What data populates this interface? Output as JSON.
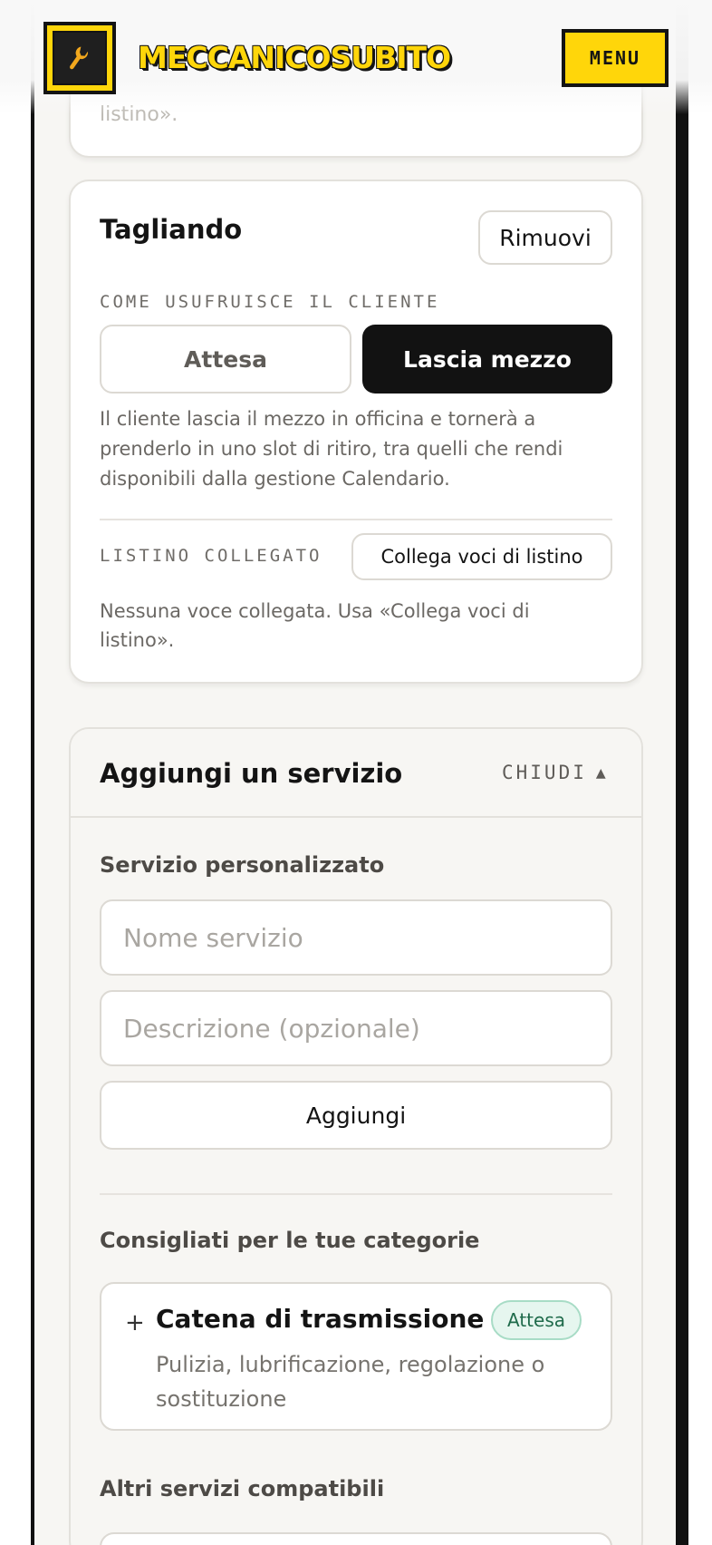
{
  "header": {
    "brand": "MECCANICOSUBITO",
    "menu_label": "MENU",
    "logo_icon": "wrench-icon",
    "accent": "#ffd60a"
  },
  "previous_card": {
    "tail_text": "listino»."
  },
  "service": {
    "title": "Tagliando",
    "remove_label": "Rimuovi",
    "usage_label": "COME USUFRUISCE IL CLIENTE",
    "option_wait": "Attesa",
    "option_leave": "Lascia mezzo",
    "selected": "Lascia mezzo",
    "usage_description": "Il cliente lascia il mezzo in officina e tornerà a prenderlo in uno slot di ritiro, tra quelli che rendi disponibili dalla gestione Calendario.",
    "listino_label": "LISTINO COLLEGATO",
    "link_list_label": "Collega voci di listino",
    "listino_empty": "Nessuna voce collegata. Usa «Collega voci di listino»."
  },
  "add_service": {
    "title": "Aggiungi un servizio",
    "close_label": "CHIUDI",
    "close_icon": "triangle-up-icon",
    "custom_heading": "Servizio personalizzato",
    "name_placeholder": "Nome servizio",
    "name_value": "",
    "description_placeholder": "Descrizione (opzionale)",
    "description_value": "",
    "add_label": "Aggiungi",
    "recommended_heading": "Consigliati per le tue categorie",
    "recommended": [
      {
        "name": "Catena di trasmissione",
        "badge": "Attesa",
        "description": "Pulizia, lubrificazione, regolazione o sostituzione"
      }
    ],
    "other_heading": "Altri servizi compatibili"
  }
}
